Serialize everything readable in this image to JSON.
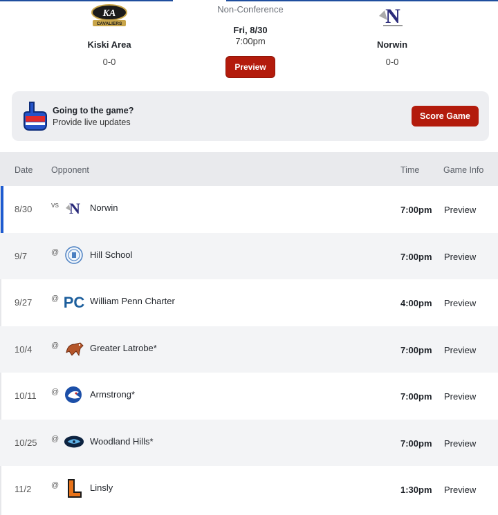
{
  "game": {
    "conference": "Non-Conference",
    "date": "Fri, 8/30",
    "time": "7:00pm",
    "preview_label": "Preview",
    "home": {
      "name": "Kiski Area",
      "record": "0-0",
      "logo_text": "KA",
      "logo_sub": "CAVALIERS"
    },
    "away": {
      "name": "Norwin",
      "record": "0-0",
      "logo_text": "N"
    }
  },
  "banner": {
    "title": "Going to the game?",
    "subtitle": "Provide live updates",
    "button_label": "Score Game"
  },
  "schedule": {
    "columns": {
      "date": "Date",
      "opponent": "Opponent",
      "time": "Time",
      "info": "Game Info"
    },
    "rows": [
      {
        "date": "8/30",
        "loc": "vs",
        "opponent": "Norwin",
        "time": "7:00pm",
        "info": "Preview",
        "logo": "norwin-logo"
      },
      {
        "date": "9/7",
        "loc": "@",
        "opponent": "Hill School",
        "time": "7:00pm",
        "info": "Preview",
        "logo": "hill-school-logo"
      },
      {
        "date": "9/27",
        "loc": "@",
        "opponent": "William Penn Charter",
        "time": "4:00pm",
        "info": "Preview",
        "logo": "penn-charter-logo"
      },
      {
        "date": "10/4",
        "loc": "@",
        "opponent": "Greater Latrobe*",
        "time": "7:00pm",
        "info": "Preview",
        "logo": "latrobe-logo"
      },
      {
        "date": "10/11",
        "loc": "@",
        "opponent": "Armstrong*",
        "time": "7:00pm",
        "info": "Preview",
        "logo": "armstrong-logo"
      },
      {
        "date": "10/25",
        "loc": "@",
        "opponent": "Woodland Hills*",
        "time": "7:00pm",
        "info": "Preview",
        "logo": "woodland-hills-logo"
      },
      {
        "date": "11/2",
        "loc": "@",
        "opponent": "Linsly",
        "time": "1:30pm",
        "info": "Preview",
        "logo": "linsly-logo"
      }
    ]
  },
  "colors": {
    "accent": "#b31b0c",
    "brand_blue": "#1e5bd0"
  }
}
